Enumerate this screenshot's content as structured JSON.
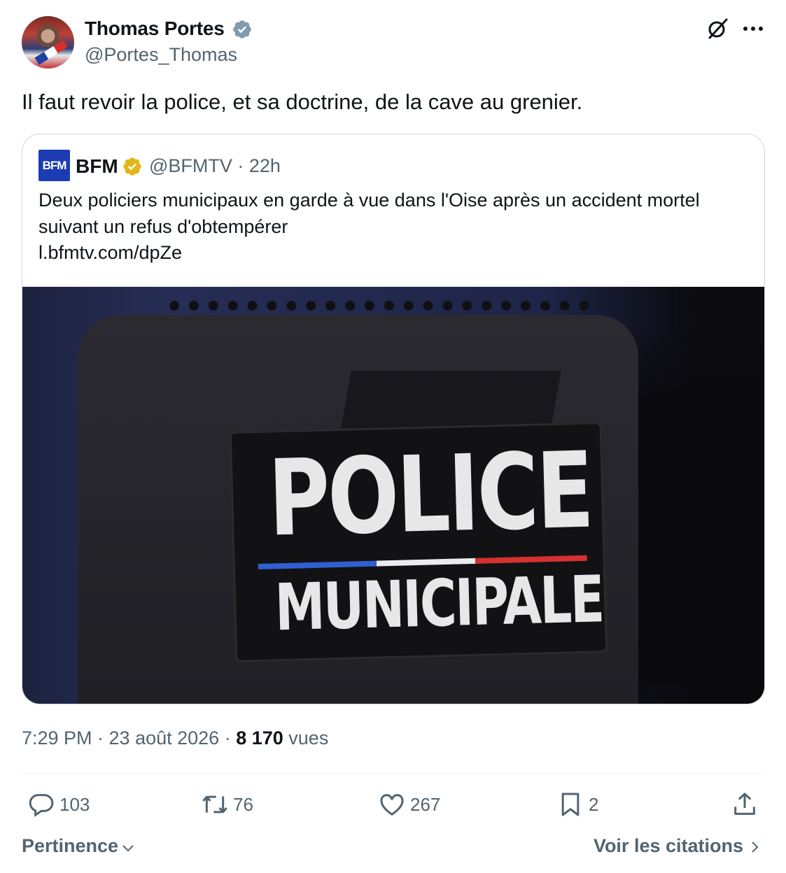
{
  "author": {
    "name": "Thomas Portes",
    "handle": "@Portes_Thomas"
  },
  "tweet": {
    "text": "Il faut revoir la police, et sa doctrine, de la cave au grenier."
  },
  "quoted": {
    "logo_text": "BFM",
    "name": "BFM",
    "meta": "@BFMTV · 22h",
    "text_lines": [
      "Deux policiers municipaux en garde à vue dans l'Oise après un accident mortel",
      "suivant un refus d'obtempérer",
      "l.bfmtv.com/dpZe"
    ],
    "image": {
      "patch_line1": "POLICE",
      "patch_line2": "MUNICIPALE"
    }
  },
  "meta": {
    "time": "7:29 PM · 23 août 2026 · ",
    "views_count": "8 170",
    "views_label": " vues"
  },
  "actions": {
    "replies": "103",
    "retweets": "76",
    "likes": "267",
    "bookmarks": "2"
  },
  "footer": {
    "sort_label": "Pertinence",
    "quotes_label": "Voir les citations"
  },
  "colors": {
    "text_primary": "#0f1419",
    "text_secondary": "#536471",
    "verified_grey": "#829aab",
    "verified_gold": "#e2b719",
    "border": "#cfd9de",
    "bfm_blue": "#1c3cb4"
  },
  "icons": [
    "verified-grey-icon",
    "grok-icon",
    "more-icon",
    "verified-gold-icon",
    "reply-icon",
    "retweet-icon",
    "like-icon",
    "bookmark-icon",
    "share-icon",
    "chevron-down-icon",
    "chevron-right-icon"
  ]
}
